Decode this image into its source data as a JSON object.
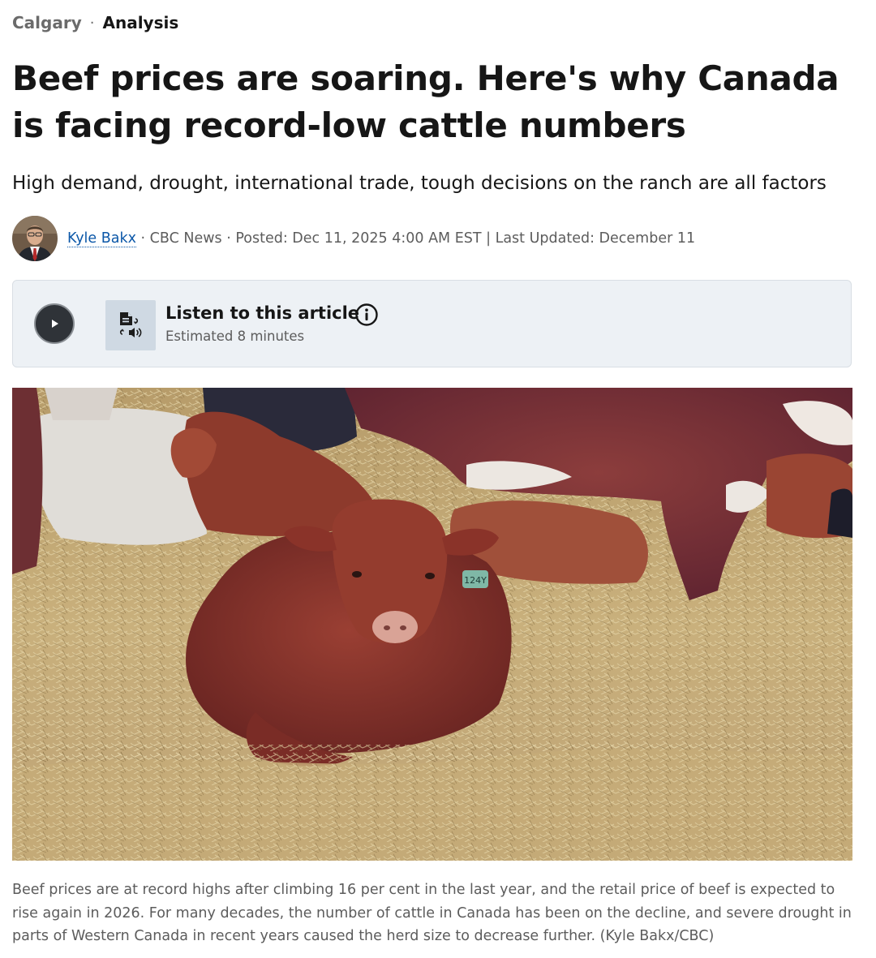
{
  "breadcrumb": {
    "city": "Calgary",
    "separator": "·",
    "label": "Analysis"
  },
  "article": {
    "headline": "Beef prices are soaring. Here's why Canada is facing record-low cattle numbers",
    "deck": "High demand, drought, international trade, tough decisions on the ranch are all factors"
  },
  "byline": {
    "author": "Kyle Bakx",
    "rest": " · CBC News · Posted: Dec 11, 2025 4:00 AM EST | Last Updated: December 11"
  },
  "audio": {
    "title": "Listen to this article",
    "duration": "Estimated 8 minutes",
    "play_icon": "play-icon",
    "tts_icon": "text-to-speech-icon",
    "info_icon": "info-icon"
  },
  "photo": {
    "ear_tag": "124Y"
  },
  "caption": "Beef prices are at record highs after climbing 16 per cent in the last year, and the retail price of beef is expected to rise again in 2026. For many decades, the number of cattle in Canada has been on the decline, and severe drought in parts of Western Canada in recent years caused the herd size to decrease further. (Kyle Bakx/CBC)",
  "colors": {
    "link": "#0b57a8",
    "text": "#161616",
    "muted": "#5c5c5c",
    "listen_bg": "#edf1f5"
  }
}
